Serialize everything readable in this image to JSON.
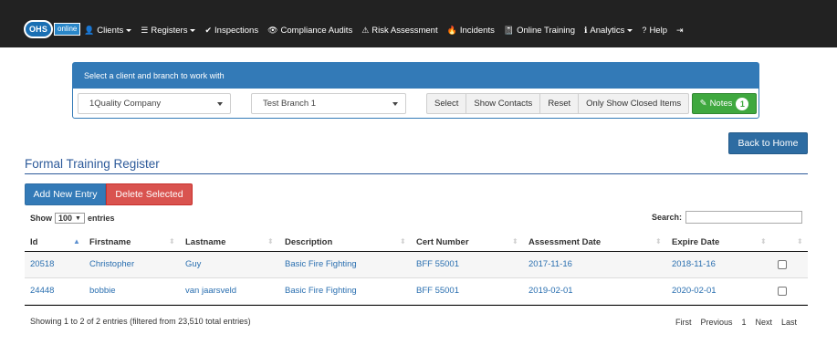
{
  "navbar": {
    "logo": {
      "part1": "OHS",
      "part2": "online"
    },
    "items": [
      {
        "icon": "👤",
        "label": "Clients",
        "dropdown": true
      },
      {
        "icon": "☰",
        "label": "Registers",
        "dropdown": true
      },
      {
        "icon": "✔",
        "label": "Inspections",
        "dropdown": false
      },
      {
        "icon": "👁",
        "label": "Compliance Audits",
        "dropdown": false
      },
      {
        "icon": "⚠",
        "label": "Risk Assessment",
        "dropdown": false
      },
      {
        "icon": "🔥",
        "label": "Incidents",
        "dropdown": false
      },
      {
        "icon": "📓",
        "label": "Online Training",
        "dropdown": false
      },
      {
        "icon": "ℹ",
        "label": "Analytics",
        "dropdown": true
      },
      {
        "icon": "?",
        "label": "Help",
        "dropdown": false
      }
    ],
    "logout_icon": "⇥"
  },
  "client_panel": {
    "heading": "Select a client and branch to work with",
    "client_value": "1Quality Company",
    "branch_value": "Test Branch 1",
    "buttons": [
      "Select",
      "Show Contacts",
      "Reset",
      "Only Show Closed Items"
    ],
    "notes_label": "Notes",
    "notes_count": "1"
  },
  "back_home_label": "Back to Home",
  "page_title": "Formal Training Register",
  "actions": {
    "add_label": "Add New Entry",
    "delete_label": "Delete Selected"
  },
  "table_controls": {
    "show_label": "Show",
    "page_length": "100",
    "entries_label": "entries",
    "search_label": "Search:",
    "search_value": ""
  },
  "table": {
    "columns": [
      "Id",
      "Firstname",
      "Lastname",
      "Description",
      "Cert Number",
      "Assessment Date",
      "Expire Date"
    ],
    "rows": [
      {
        "id": "20518",
        "firstname": "Christopher",
        "lastname": "Guy",
        "description": "Basic Fire Fighting",
        "cert": "BFF 55001",
        "assessment": "2017-11-16",
        "expire": "2018-11-16"
      },
      {
        "id": "24448",
        "firstname": "bobbie",
        "lastname": "van jaarsveld",
        "description": "Basic Fire Fighting",
        "cert": "BFF 55001",
        "assessment": "2019-02-01",
        "expire": "2020-02-01"
      }
    ]
  },
  "footer": {
    "info": "Showing 1 to 2 of 2 entries (filtered from 23,510 total entries)",
    "pagination": [
      "First",
      "Previous",
      "1",
      "Next",
      "Last"
    ]
  },
  "colors": {
    "navbar_bg": "#222222",
    "primary": "#337ab7",
    "danger": "#d9534f",
    "success": "#3fa83f",
    "title": "#2d5a9a",
    "link": "#2a6fb0"
  }
}
